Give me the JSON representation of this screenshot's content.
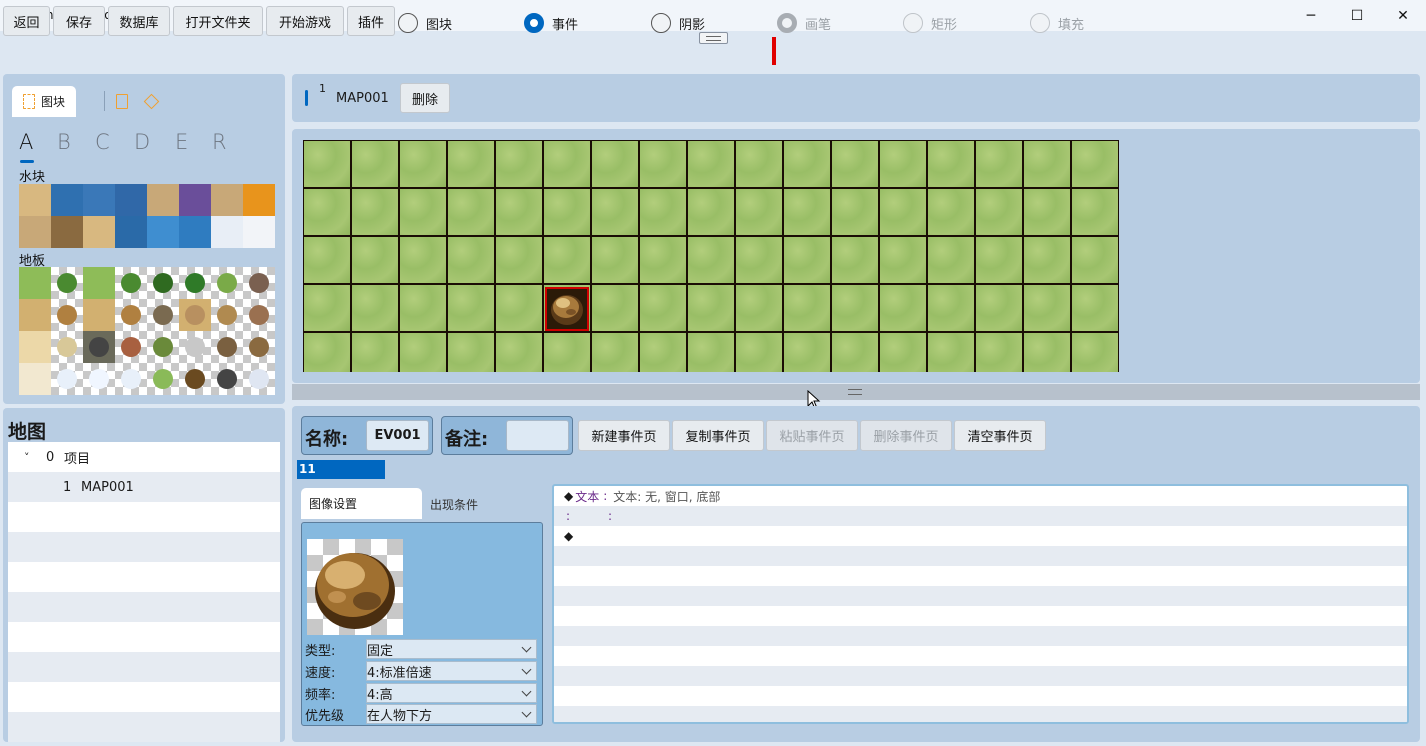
{
  "window": {
    "title": "WinUI Desktop",
    "minimize": "─",
    "maximize": "☐",
    "close": "✕"
  },
  "toolbar": {
    "buttons": [
      "返回",
      "保存",
      "数据库",
      "打开文件夹",
      "开始游戏",
      "插件"
    ],
    "radios": [
      {
        "label": "图块",
        "selected": false,
        "enabled": true
      },
      {
        "label": "事件",
        "selected": true,
        "enabled": true
      },
      {
        "label": "阴影",
        "selected": false,
        "enabled": true
      },
      {
        "label": "画笔",
        "selected": false,
        "enabled": false
      },
      {
        "label": "矩形",
        "selected": false,
        "enabled": false
      },
      {
        "label": "填充",
        "selected": false,
        "enabled": false
      }
    ],
    "accent_color": "#0067c0",
    "pen_color": "#e00000"
  },
  "tileset": {
    "tab_label": "图块",
    "letters": [
      "A",
      "B",
      "C",
      "D",
      "E",
      "R"
    ],
    "selected_letter": "A",
    "groups": [
      {
        "label": "水块",
        "rows": 2
      },
      {
        "label": "地板",
        "rows": 4
      }
    ]
  },
  "map_tree": {
    "title": "地图",
    "items": [
      {
        "expander": "˅",
        "id": "0",
        "name": "项目"
      },
      {
        "expander": "",
        "id": "1",
        "name": "MAP001"
      }
    ]
  },
  "map_tab": {
    "index": "1",
    "name": "MAP001",
    "delete_label": "删除"
  },
  "map": {
    "columns": 17,
    "rows": 5,
    "event_position": {
      "col": 5,
      "row": 3
    }
  },
  "event": {
    "name_label": "名称:",
    "name_value": "EV001",
    "note_label": "备注:",
    "note_value": "",
    "buttons": [
      {
        "label": "新建事件页",
        "enabled": true
      },
      {
        "label": "复制事件页",
        "enabled": true
      },
      {
        "label": "粘贴事件页",
        "enabled": false
      },
      {
        "label": "删除事件页",
        "enabled": false
      },
      {
        "label": "清空事件页",
        "enabled": true
      }
    ],
    "page_tab": "11",
    "tabs": [
      "图像设置",
      "出现条件"
    ],
    "props": [
      {
        "label": "类型:",
        "value": "固定"
      },
      {
        "label": "速度:",
        "value": "4:标准倍速"
      },
      {
        "label": "频率:",
        "value": "4:高"
      },
      {
        "label": "优先级",
        "value": "在人物下方"
      }
    ],
    "commands": [
      {
        "marker": "◆",
        "name": "文本",
        "sep": ":",
        "detail": "文本: 无, 窗口, 底部"
      },
      {
        "marker": "",
        "name": ":",
        "sep": ":",
        "detail": ""
      },
      {
        "marker": "◆",
        "name": "",
        "sep": "",
        "detail": ""
      }
    ]
  }
}
